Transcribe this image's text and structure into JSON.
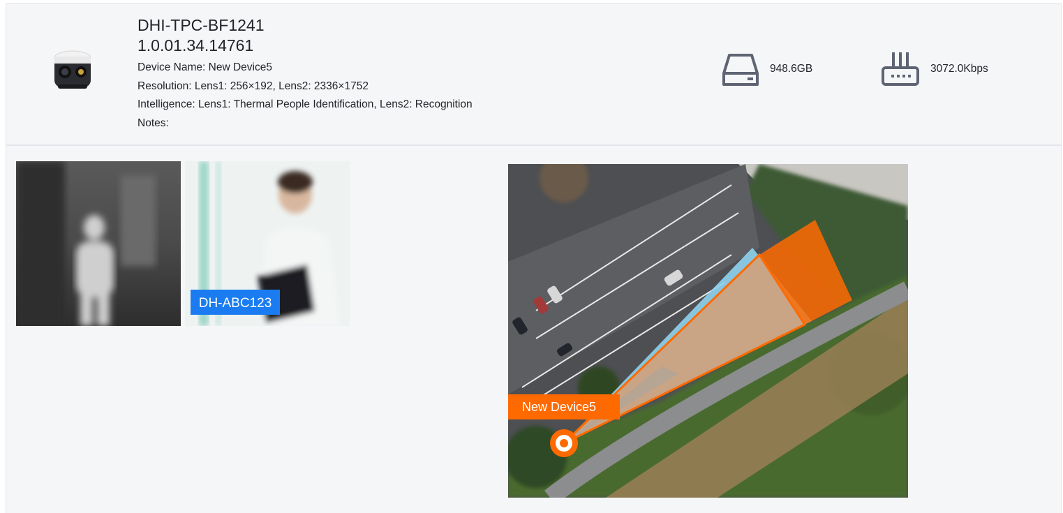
{
  "device": {
    "model": "DHI-TPC-BF1241",
    "firmware": "1.0.01.34.14761",
    "name_line": "Device Name: New Device5",
    "resolution_line": "Resolution: Lens1: 256×192, Lens2: 2336×1752",
    "intelligence_line": "Intelligence: Lens1: Thermal People Identification, Lens2: Recognition",
    "notes_line": "Notes:"
  },
  "stats": {
    "storage": {
      "icon": "hard-drive-icon",
      "value": "948.6GB"
    },
    "bitrate": {
      "icon": "router-icon",
      "value": "3072.0Kbps"
    }
  },
  "snapshots": {
    "plate_label": "DH-ABC123"
  },
  "map": {
    "device_label": "New Device5",
    "accent": "#ff6a00",
    "fov_colors": [
      "#ff6a00",
      "#8fd3f0"
    ]
  }
}
